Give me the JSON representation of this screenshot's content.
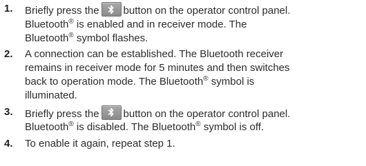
{
  "steps": [
    {
      "number": "1.",
      "lines": [
        {
          "before": "Briefly press the",
          "after": "button on the operator control panel."
        },
        {
          "a": "Bluetooth",
          "reg": "®",
          "b": " is enabled and in receiver mode. The"
        },
        {
          "a": "Bluetooth",
          "reg": "®",
          "b": " symbol flashes."
        }
      ]
    },
    {
      "number": "2.",
      "lines": [
        "A connection can be established. The Bluetooth receiver",
        "remains in receiver mode for 5 minutes and then switches",
        {
          "a": "back to operation mode. The Bluetooth",
          "reg": "®",
          "b": " symbol is"
        },
        "illuminated."
      ]
    },
    {
      "number": "3.",
      "lines": [
        {
          "before": "Briefly press the",
          "after": "button on the operator control panel."
        },
        {
          "a": "Bluetooth",
          "reg": "®",
          "b": " is disabled. The Bluetooth",
          "reg2": "®",
          "c": " symbol is off."
        }
      ]
    },
    {
      "number": "4.",
      "lines": [
        "To enable it again, repeat step 1."
      ]
    }
  ],
  "icons": {
    "bluetooth_button": "bluetooth-icon"
  }
}
